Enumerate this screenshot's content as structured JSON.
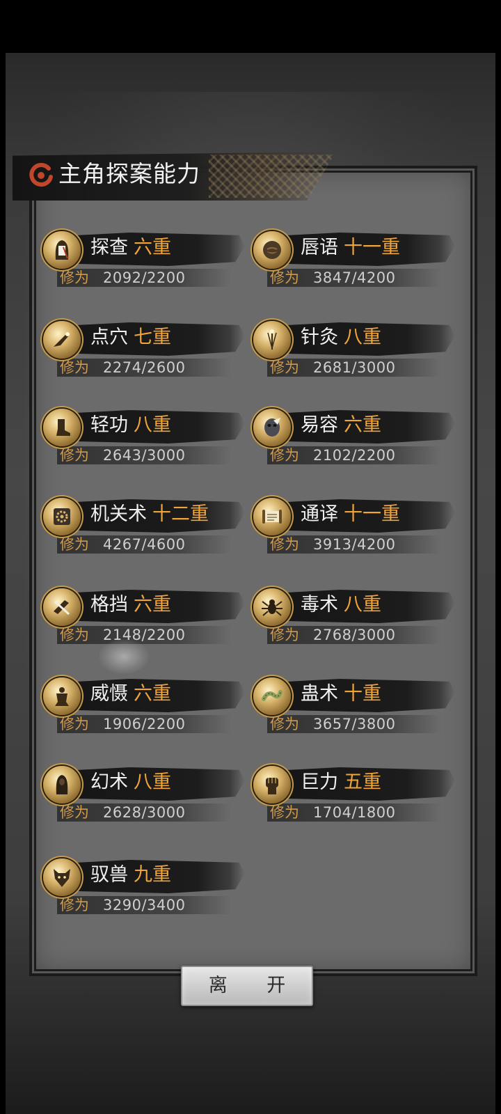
{
  "title": "主角探案能力",
  "exp_label": "修为",
  "leave_label": "离 开",
  "colors": {
    "level": "#f0a43a",
    "exp_label": "#d19a4b",
    "name": "#f0f0f0"
  },
  "skills": [
    {
      "name": "探查",
      "level": "六重",
      "exp": "2092/2200",
      "progress": 0.951,
      "icon": "hooded-figure-icon"
    },
    {
      "name": "唇语",
      "level": "十一重",
      "exp": "3847/4200",
      "progress": 0.916,
      "icon": "mouth-icon"
    },
    {
      "name": "点穴",
      "level": "七重",
      "exp": "2274/2600",
      "progress": 0.875,
      "icon": "finger-strike-icon"
    },
    {
      "name": "针灸",
      "level": "八重",
      "exp": "2681/3000",
      "progress": 0.894,
      "icon": "needle-icon"
    },
    {
      "name": "轻功",
      "level": "八重",
      "exp": "2643/3000",
      "progress": 0.881,
      "icon": "boot-icon"
    },
    {
      "name": "易容",
      "level": "六重",
      "exp": "2102/2200",
      "progress": 0.955,
      "icon": "mask-icon"
    },
    {
      "name": "机关术",
      "level": "十二重",
      "exp": "4267/4600",
      "progress": 0.928,
      "icon": "gear-icon"
    },
    {
      "name": "通译",
      "level": "十一重",
      "exp": "3913/4200",
      "progress": 0.932,
      "icon": "scroll-icon"
    },
    {
      "name": "格挡",
      "level": "六重",
      "exp": "2148/2200",
      "progress": 0.976,
      "icon": "block-icon"
    },
    {
      "name": "毒术",
      "level": "八重",
      "exp": "2768/3000",
      "progress": 0.923,
      "icon": "spider-icon"
    },
    {
      "name": "威慑",
      "level": "六重",
      "exp": "1906/2200",
      "progress": 0.866,
      "icon": "statue-icon"
    },
    {
      "name": "蛊术",
      "level": "十重",
      "exp": "3657/3800",
      "progress": 0.962,
      "icon": "worm-icon"
    },
    {
      "name": "幻术",
      "level": "八重",
      "exp": "2628/3000",
      "progress": 0.876,
      "icon": "illusion-figure-icon"
    },
    {
      "name": "巨力",
      "level": "五重",
      "exp": "1704/1800",
      "progress": 0.947,
      "icon": "fist-icon"
    },
    {
      "name": "驭兽",
      "level": "九重",
      "exp": "3290/3400",
      "progress": 0.968,
      "icon": "wolf-icon"
    }
  ]
}
